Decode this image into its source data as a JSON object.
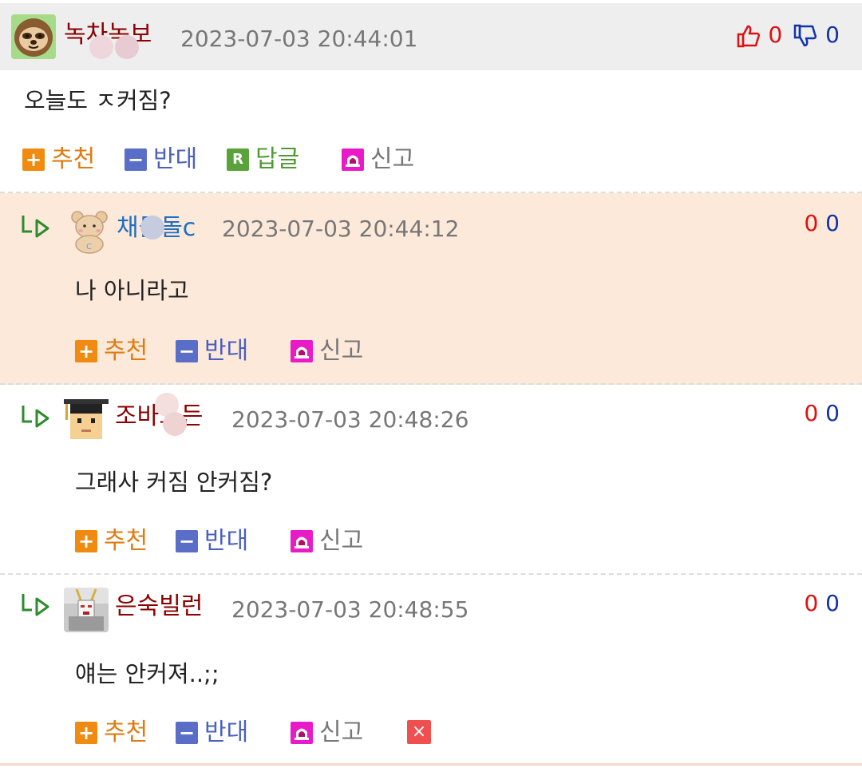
{
  "comments": [
    {
      "username": "녹차녹보",
      "timestamp": "2023-07-03 20:44:01",
      "body": "오늘도 ㅈ커짐?",
      "upvotes": "0",
      "downvotes": "0",
      "actions": {
        "recommend": "추천",
        "oppose": "반대",
        "reply": "답글",
        "report": "신고"
      }
    },
    {
      "username": "채돌돌c",
      "timestamp": "2023-07-03 20:44:12",
      "body": "나 아니라고",
      "upvotes": "0",
      "downvotes": "0",
      "actions": {
        "recommend": "추천",
        "oppose": "반대",
        "report": "신고"
      }
    },
    {
      "username": "조바드든",
      "timestamp": "2023-07-03 20:48:26",
      "body": "그래사 커짐 안커짐?",
      "upvotes": "0",
      "downvotes": "0",
      "actions": {
        "recommend": "추천",
        "oppose": "반대",
        "report": "신고"
      }
    },
    {
      "username": "은숙빌런",
      "timestamp": "2023-07-03 20:48:55",
      "body": "얘는 안커져..;;",
      "upvotes": "0",
      "downvotes": "0",
      "actions": {
        "recommend": "추천",
        "oppose": "반대",
        "report": "신고",
        "delete": "×"
      }
    }
  ],
  "icons": {
    "recommend": "plus-icon",
    "oppose": "minus-icon",
    "reply": "reply-icon",
    "report": "siren-icon",
    "delete": "close-icon",
    "thumbs_up": "thumbs-up-icon",
    "thumbs_down": "thumbs-down-icon",
    "reply_marker": "reply-arrow-icon"
  },
  "colors": {
    "recommend": "#f08a10",
    "oppose": "#5a6ec8",
    "reply": "#5aa33a",
    "report": "#e91bc9",
    "delete": "#ef4f4f",
    "highlight_row": "#fce9d9",
    "upvote": "#dd1111",
    "downvote": "#1133aa"
  }
}
